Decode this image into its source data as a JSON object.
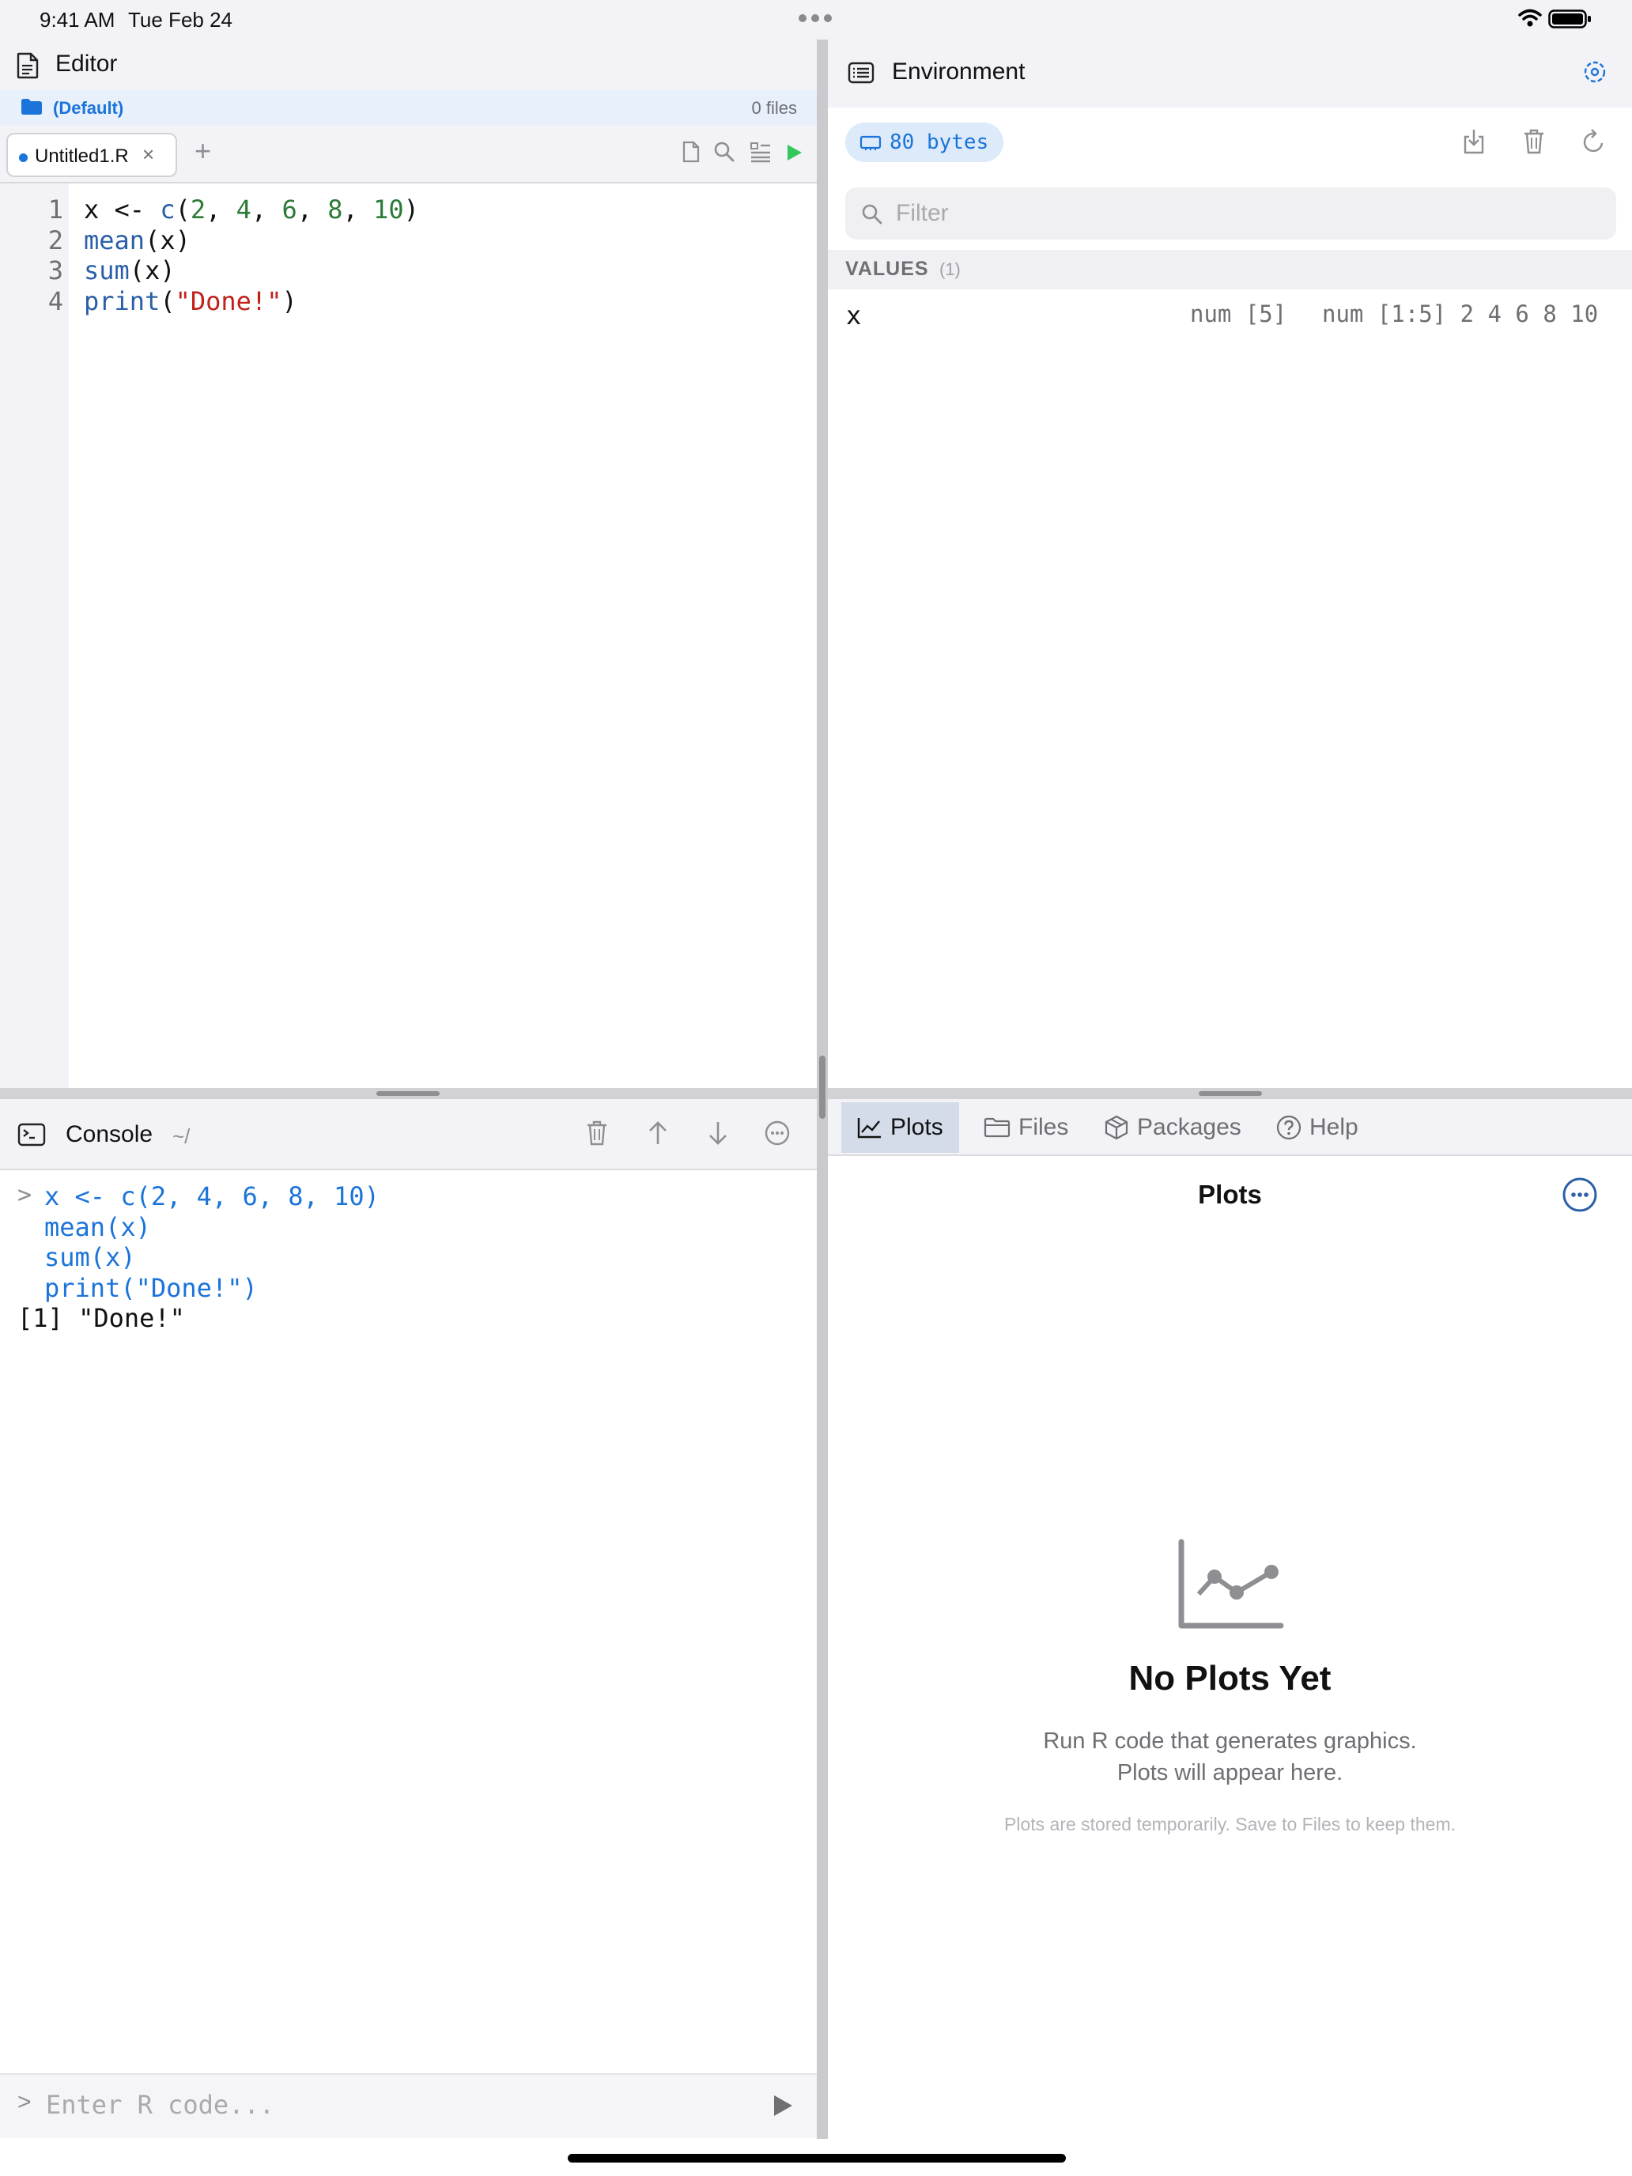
{
  "status_bar": {
    "time": "9:41 AM",
    "date": "Tue Feb 24"
  },
  "editor": {
    "title": "Editor",
    "project": {
      "name": "(Default)",
      "file_count": "0 files"
    },
    "tabs": [
      {
        "label": "Untitled1.R",
        "modified": true
      }
    ],
    "lines": [
      {
        "no": "1",
        "tokens": [
          {
            "t": "x <- ",
            "c": "plain"
          },
          {
            "t": "c",
            "c": "fn"
          },
          {
            "t": "(",
            "c": "plain"
          },
          {
            "t": "2",
            "c": "num"
          },
          {
            "t": ", ",
            "c": "plain"
          },
          {
            "t": "4",
            "c": "num"
          },
          {
            "t": ", ",
            "c": "plain"
          },
          {
            "t": "6",
            "c": "num"
          },
          {
            "t": ", ",
            "c": "plain"
          },
          {
            "t": "8",
            "c": "num"
          },
          {
            "t": ", ",
            "c": "plain"
          },
          {
            "t": "10",
            "c": "num"
          },
          {
            "t": ")",
            "c": "plain"
          }
        ]
      },
      {
        "no": "2",
        "tokens": [
          {
            "t": "mean",
            "c": "fn"
          },
          {
            "t": "(x)",
            "c": "plain"
          }
        ]
      },
      {
        "no": "3",
        "tokens": [
          {
            "t": "sum",
            "c": "fn"
          },
          {
            "t": "(x)",
            "c": "plain"
          }
        ]
      },
      {
        "no": "4",
        "tokens": [
          {
            "t": "print",
            "c": "fn"
          },
          {
            "t": "(",
            "c": "plain"
          },
          {
            "t": "\"Done!\"",
            "c": "str"
          },
          {
            "t": ")",
            "c": "plain"
          }
        ]
      }
    ]
  },
  "console": {
    "title": "Console",
    "path": "~/",
    "prompt": ">",
    "history": [
      {
        "prefix": ">",
        "text": "x <- c(2, 4, 6, 8, 10)",
        "kind": "input"
      },
      {
        "prefix": " ",
        "text": "mean(x)",
        "kind": "input"
      },
      {
        "prefix": " ",
        "text": "sum(x)",
        "kind": "input"
      },
      {
        "prefix": " ",
        "text": "print(\"Done!\")",
        "kind": "input"
      },
      {
        "prefix": "",
        "text": "[1] \"Done!\"",
        "kind": "output"
      }
    ],
    "input_placeholder": "Enter R code...",
    "input_value": ""
  },
  "environment": {
    "title": "Environment",
    "memory": "80 bytes",
    "filter_placeholder": "Filter",
    "section_title": "VALUES",
    "section_count": "(1)",
    "variables": [
      {
        "name": "x",
        "type": "num [5]",
        "value": "num [1:5] 2 4 6 8 10"
      }
    ]
  },
  "pane_tabs": [
    {
      "label": "Plots",
      "icon": "chart-line-icon",
      "active": true
    },
    {
      "label": "Files",
      "icon": "folder-icon",
      "active": false
    },
    {
      "label": "Packages",
      "icon": "package-icon",
      "active": false
    },
    {
      "label": "Help",
      "icon": "help-icon",
      "active": false
    }
  ],
  "plots": {
    "title": "Plots",
    "empty_title": "No Plots Yet",
    "empty_line1": "Run R code that generates graphics.",
    "empty_line2": "Plots will appear here.",
    "empty_note": "Plots are stored temporarily. Save to Files to keep them."
  },
  "colors": {
    "accent": "#1b74d9",
    "run_green": "#34c759",
    "code_function": "#2a5fa8",
    "code_number": "#2b7a37",
    "code_string": "#c1211a"
  }
}
